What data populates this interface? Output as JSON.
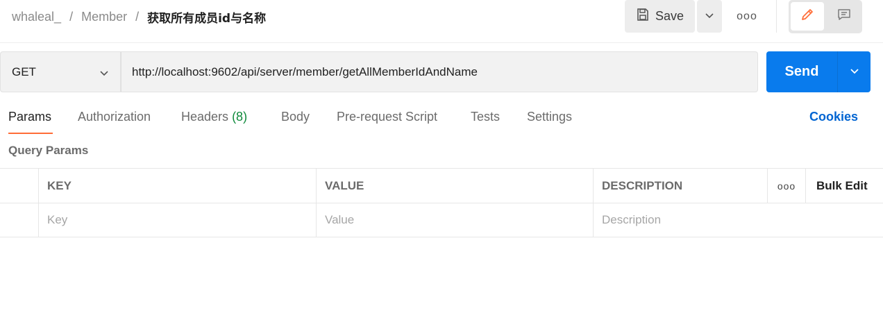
{
  "breadcrumb": {
    "workspace": "whaleal_",
    "collection": "Member",
    "request": "获取所有成员id与名称",
    "separator": "/"
  },
  "toolbar": {
    "save_label": "Save",
    "more_label": "ooo",
    "save_icon": "floppy-disk-icon",
    "edit_icon": "pencil-icon",
    "comment_icon": "comment-icon"
  },
  "request": {
    "method": "GET",
    "url": "http://localhost:9602/api/server/member/getAllMemberIdAndName",
    "send_label": "Send"
  },
  "tabs": [
    {
      "label": "Params",
      "active": true
    },
    {
      "label": "Authorization"
    },
    {
      "label": "Headers",
      "count": "(8)"
    },
    {
      "label": "Body"
    },
    {
      "label": "Pre-request Script"
    },
    {
      "label": "Tests"
    },
    {
      "label": "Settings"
    }
  ],
  "cookies_label": "Cookies",
  "query_params": {
    "title": "Query Params",
    "columns": {
      "key": "KEY",
      "value": "VALUE",
      "description": "DESCRIPTION",
      "more": "ooo",
      "bulk_edit": "Bulk Edit"
    },
    "placeholders": {
      "key": "Key",
      "value": "Value",
      "description": "Description"
    }
  },
  "colors": {
    "accent_send": "#097bed",
    "tab_underline": "#ff6c37",
    "cookies_link": "#0265d2",
    "headers_count": "#0f8a3b",
    "edit_icon": "#ff6c37"
  }
}
